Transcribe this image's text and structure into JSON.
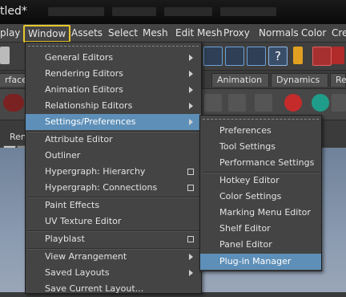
{
  "title_fragment": "tled*",
  "menubar": [
    "play",
    "Window",
    "Assets",
    "Select",
    "Mesh",
    "Edit Mesh",
    "Proxy",
    "Normals",
    "Color",
    "Cre"
  ],
  "shelf_tabs": [
    "rfaces",
    "Animation",
    "Dynamics",
    "Re"
  ],
  "lower_label": "Ren",
  "window_menu": [
    {
      "label": "General Editors",
      "arrow": true
    },
    {
      "label": "Rendering Editors",
      "arrow": true
    },
    {
      "label": "Animation Editors",
      "arrow": true
    },
    {
      "label": "Relationship Editors",
      "arrow": true
    },
    {
      "label": "Settings/Preferences",
      "arrow": true,
      "highlight": true
    },
    {
      "label": "Attribute Editor"
    },
    {
      "label": "Outliner"
    },
    {
      "label": "Hypergraph: Hierarchy",
      "box": true
    },
    {
      "label": "Hypergraph: Connections",
      "box": true
    },
    {
      "label": "Paint Effects"
    },
    {
      "label": "UV Texture Editor"
    },
    {
      "label": "Playblast",
      "box": true
    },
    {
      "label": "View Arrangement",
      "arrow": true
    },
    {
      "label": "Saved Layouts",
      "arrow": true
    },
    {
      "label": "Save Current Layout..."
    }
  ],
  "settings_submenu": [
    {
      "label": "Preferences"
    },
    {
      "label": "Tool Settings"
    },
    {
      "label": "Performance Settings"
    },
    {
      "label": "Hotkey Editor"
    },
    {
      "label": "Color Settings"
    },
    {
      "label": "Marking Menu Editor"
    },
    {
      "label": "Shelf Editor"
    },
    {
      "label": "Panel Editor"
    },
    {
      "label": "Plug-in Manager",
      "highlight": true
    }
  ],
  "colors": {
    "highlight": "#5d8fb8",
    "active_outline": "#e8c72b"
  }
}
